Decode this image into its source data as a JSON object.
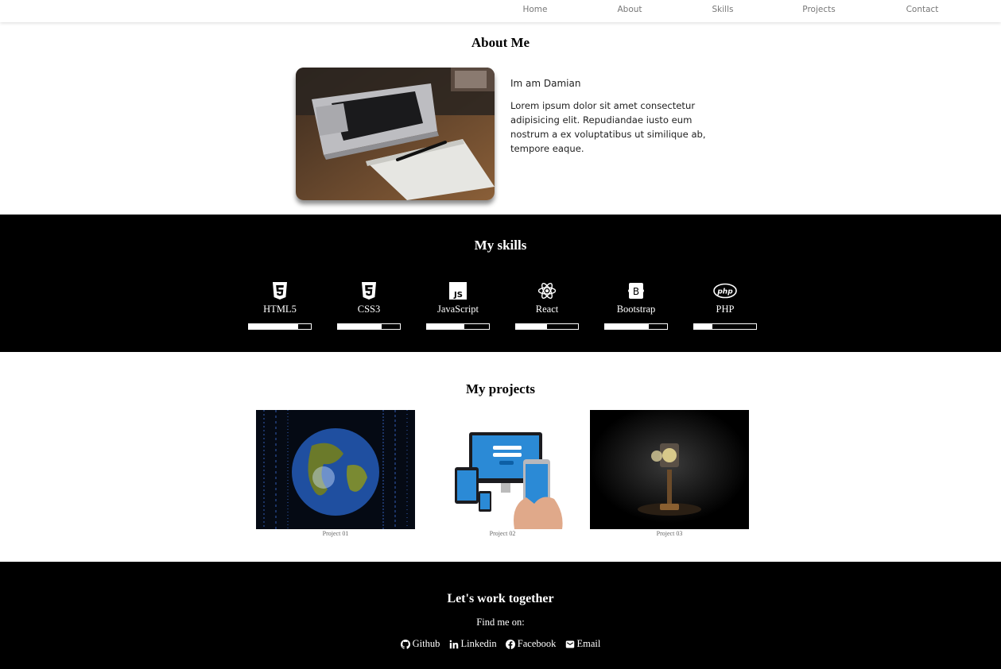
{
  "nav": {
    "items": [
      "Home",
      "About",
      "Skills",
      "Projects",
      "Contact"
    ]
  },
  "about": {
    "title": "About Me",
    "greeting": "Im am Damian",
    "bio": "Lorem ipsum dolor sit amet consectetur adipisicing elit. Repudiandae iusto eum nostrum a ex voluptatibus ut similique ab, tempore eaque."
  },
  "skills": {
    "title": "My skills",
    "items": [
      {
        "label": "HTML5",
        "icon": "html5-icon",
        "level": 0.8
      },
      {
        "label": "CSS3",
        "icon": "css3-icon",
        "level": 0.7
      },
      {
        "label": "JavaScript",
        "icon": "javascript-icon",
        "level": 0.6
      },
      {
        "label": "React",
        "icon": "react-icon",
        "level": 0.5
      },
      {
        "label": "Bootstrap",
        "icon": "bootstrap-icon",
        "level": 0.7
      },
      {
        "label": "PHP",
        "icon": "php-icon",
        "level": 0.3
      }
    ]
  },
  "projects": {
    "title": "My projects",
    "items": [
      {
        "caption": "Project 01"
      },
      {
        "caption": "Project 02"
      },
      {
        "caption": "Project 03"
      }
    ]
  },
  "footer": {
    "title": "Let's work together",
    "find_label": "Find me on:",
    "links": [
      {
        "label": "Github",
        "icon": "github-icon"
      },
      {
        "label": "Linkedin",
        "icon": "linkedin-icon"
      },
      {
        "label": "Facebook",
        "icon": "facebook-icon"
      },
      {
        "label": "Email",
        "icon": "envelope-icon"
      }
    ]
  },
  "colors": {
    "dark_section": "#000000",
    "light_section": "#ffffff",
    "nav_text": "#777777"
  }
}
